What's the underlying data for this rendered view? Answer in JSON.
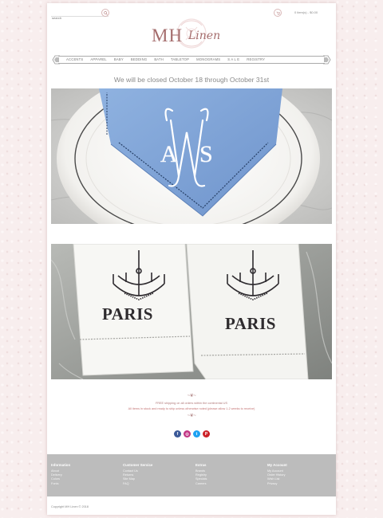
{
  "header": {
    "search_placeholder": "search",
    "cart_text": "0 item(s) - $0.00",
    "logo_mh": "MH",
    "logo_linen": "Linen"
  },
  "nav": {
    "items": [
      "ACCENTS",
      "APPAREL",
      "BABY",
      "BEDDING",
      "BATH",
      "TABLETOP",
      "MONOGRAMS",
      "S A L E",
      "REGISTRY"
    ]
  },
  "notice": "We will be closed October 18 through October 31st",
  "images": {
    "napkin_monogram": [
      "A",
      "W",
      "S"
    ],
    "towel_text": "PARIS"
  },
  "info": {
    "divider": "~❦~",
    "shipping": "FREE shipping on all orders within the continental US",
    "in_stock": "All items in stock and ready to ship unless otherwise noted (please allow 1-2 weeks to receive)"
  },
  "social": {
    "facebook": "f",
    "instagram": "◎",
    "twitter": "t",
    "pinterest": "P",
    "colors": {
      "facebook": "#3b5998",
      "instagram": "#c13584",
      "twitter": "#1da1f2",
      "pinterest": "#cb2027"
    }
  },
  "footer": {
    "columns": [
      {
        "title": "Information",
        "links": [
          "About",
          "Delivery",
          "Colors",
          "Fonts"
        ]
      },
      {
        "title": "Customer Service",
        "links": [
          "Contact Us",
          "Returns",
          "Site Map",
          "FAQ"
        ]
      },
      {
        "title": "Extras",
        "links": [
          "Brands",
          "Registry",
          "Specials",
          "Careers"
        ]
      },
      {
        "title": "My Account",
        "links": [
          "My Account",
          "Order History",
          "Wish List",
          "Privacy"
        ]
      }
    ],
    "copyright": "Copyright MH Linen © 2018"
  },
  "colors": {
    "brand": "#a56d6d",
    "footer": "#bcbcbc",
    "background": "#f8eeee"
  }
}
